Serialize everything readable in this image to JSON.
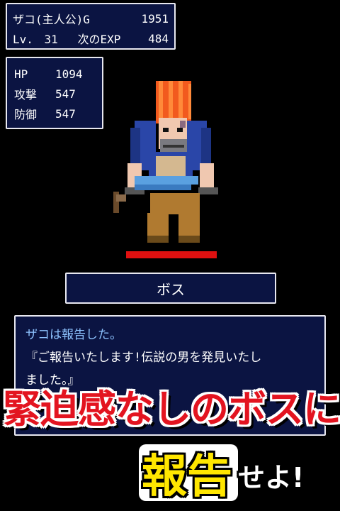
{
  "status_top": {
    "name": "ザコ(主人公)",
    "gold_label": "G",
    "gold": "1951",
    "level_label": "Lv.",
    "level": "31",
    "next_exp_label": "次のEXP",
    "next_exp": "484"
  },
  "stats": [
    {
      "label": "HP",
      "value": "1094"
    },
    {
      "label": "攻撃",
      "value": "547"
    },
    {
      "label": "防御",
      "value": "547"
    }
  ],
  "enemy": {
    "icon": "boss-sprite",
    "name": "ボス",
    "hp_fraction": 1.0,
    "hp_color": "#e01010"
  },
  "message": {
    "line1": "ザコは報告した。",
    "line2": "『ご報告いたします!伝説の男を発見いたし",
    "line3": "ました。』"
  },
  "promo": {
    "line1": "緊迫感なしのボスに",
    "line2_big": "報告",
    "line2_small": "せよ!"
  },
  "colors": {
    "panel_bg": "#0b1442",
    "panel_border": "#e8e8f0",
    "speaker": "#8ec3ff",
    "promo_red": "#e31420",
    "promo_yellow": "#ffe600"
  }
}
